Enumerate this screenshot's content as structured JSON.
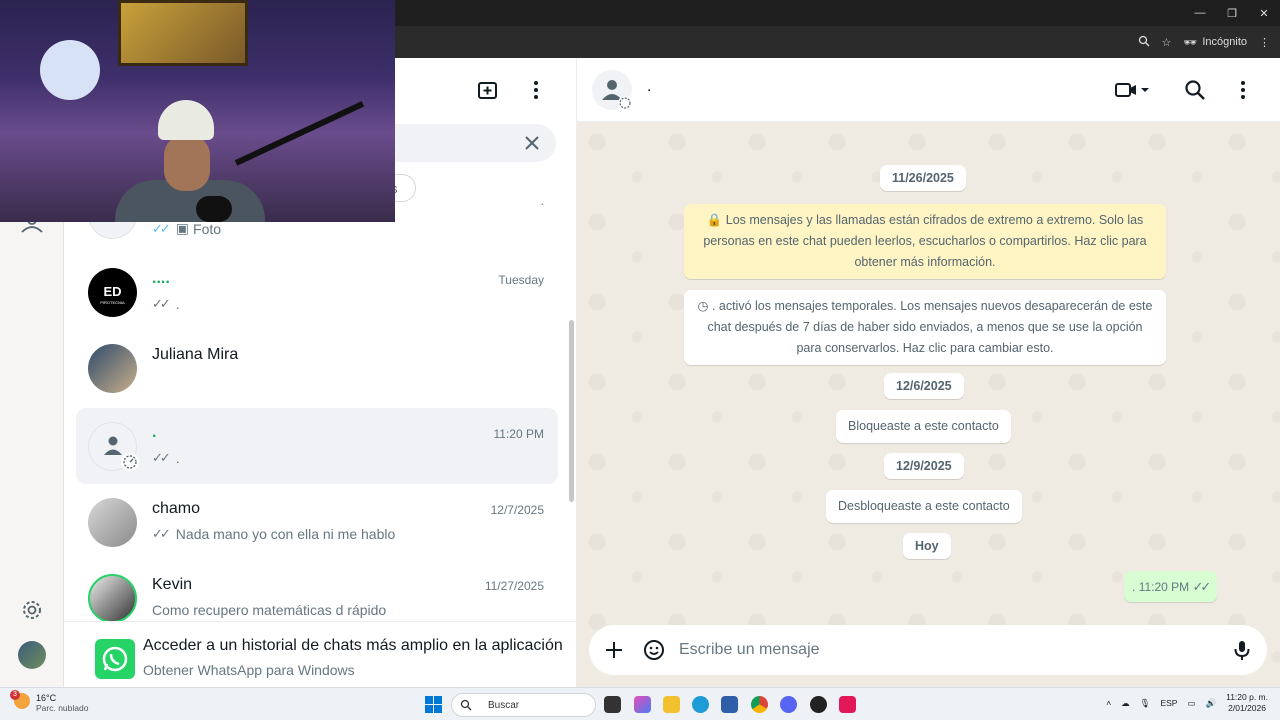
{
  "browser": {
    "incognito_label": "Incógnito",
    "window_controls": [
      "—",
      "❐",
      "✕"
    ]
  },
  "webcam": {
    "description_icon": "webcam-overlay"
  },
  "chat_list": {
    "filter_chip": "s",
    "items": [
      {
        "name": "",
        "time": ".",
        "message": "Foto",
        "ticks": "✓✓",
        "avatar": "grey"
      },
      {
        "name": "....",
        "time": "Tuesday",
        "message": ".",
        "ticks": "✓✓",
        "avatar": "ED PIROTECNIA"
      },
      {
        "name": "Juliana Mira",
        "time": "",
        "message": "",
        "ticks": "",
        "avatar": "photo"
      },
      {
        "name": ".",
        "time": "11:20 PM",
        "message": ".",
        "ticks": "✓✓",
        "avatar": "default"
      },
      {
        "name": "chamo",
        "time": "12/7/2025",
        "message": "Nada mano yo con ella ni me hablo",
        "ticks": "✓✓",
        "avatar": "photo"
      },
      {
        "name": "Kevin",
        "time": "11/27/2025",
        "message": "Como recupero matemáticas d rápido",
        "ticks": "",
        "avatar": "photo"
      }
    ],
    "avatar_text": "ED",
    "avatar_subtext": "PIROTECNIA"
  },
  "promo": {
    "title": "Acceder a un historial de chats más amplio en la aplicación",
    "subtitle": "Obtener WhatsApp para Windows"
  },
  "conversation": {
    "contact_name": ".",
    "messages": {
      "date1": "11/26/2025",
      "encryption": "Los mensajes y las llamadas están cifrados de extremo a extremo. Solo las personas en este chat pueden leerlos, escucharlos o compartirlos. Haz clic para obtener más información.",
      "temporal": ". activó los mensajes temporales. Los mensajes nuevos desaparecerán de este chat después de 7 días de haber sido enviados, a menos que se use la opción para conservarlos. Haz clic para cambiar esto.",
      "date2": "12/6/2025",
      "blocked": "Bloqueaste a este contacto",
      "date3": "12/9/2025",
      "unblocked": "Desbloqueaste a este contacto",
      "today": "Hoy",
      "outgoing_text": ".",
      "outgoing_time": "11:20 PM",
      "outgoing_ticks": "✓✓"
    },
    "composer_placeholder": "Escribe un mensaje"
  },
  "taskbar": {
    "weather_temp": "16°C",
    "weather_desc": "Parc. nublado",
    "weather_badge": "3",
    "search_label": "Buscar",
    "language": "ESP",
    "time": "11:20 p. m.",
    "date": "2/01/2026"
  },
  "colors": {
    "accent": "#25d366",
    "chat_bg": "#efeae2",
    "encryption_bg": "#fff5c4",
    "outgoing_bg": "#d9fdd3"
  }
}
